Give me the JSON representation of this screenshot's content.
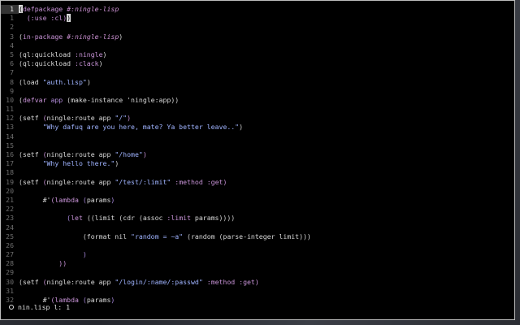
{
  "editor": {
    "lines": [
      {
        "num": "1",
        "current": true,
        "parts": [
          {
            "t": "(",
            "c": "cursor"
          },
          {
            "t": "defpackage ",
            "c": "kw"
          },
          {
            "t": "#:ningle-lisp",
            "c": "sym"
          }
        ]
      },
      {
        "num": "1",
        "parts": [
          {
            "t": "  (:use :cl)",
            "c": "paren2"
          },
          {
            "t": ")",
            "c": "cursor"
          }
        ]
      },
      {
        "num": "2",
        "parts": []
      },
      {
        "num": "3",
        "parts": [
          {
            "t": "(",
            "c": ""
          },
          {
            "t": "in-package ",
            "c": "kw"
          },
          {
            "t": "#:ningle-lisp",
            "c": "sym"
          },
          {
            "t": ")",
            "c": ""
          }
        ]
      },
      {
        "num": "4",
        "parts": []
      },
      {
        "num": "5",
        "parts": [
          {
            "t": "(ql:quickload ",
            "c": ""
          },
          {
            "t": ":ningle",
            "c": "kw"
          },
          {
            "t": ")",
            "c": ""
          }
        ]
      },
      {
        "num": "6",
        "parts": [
          {
            "t": "(ql:quickload ",
            "c": ""
          },
          {
            "t": ":clack",
            "c": "kw"
          },
          {
            "t": ")",
            "c": ""
          }
        ]
      },
      {
        "num": "7",
        "parts": []
      },
      {
        "num": "8",
        "parts": [
          {
            "t": "(load ",
            "c": ""
          },
          {
            "t": "\"auth.lisp\"",
            "c": "str"
          },
          {
            "t": ")",
            "c": ""
          }
        ]
      },
      {
        "num": "9",
        "parts": []
      },
      {
        "num": "10",
        "parts": [
          {
            "t": "(",
            "c": ""
          },
          {
            "t": "defvar ",
            "c": "kw"
          },
          {
            "t": "app ",
            "c": "kw2"
          },
          {
            "t": "(make-instance 'ningle:app))",
            "c": ""
          }
        ]
      },
      {
        "num": "11",
        "parts": []
      },
      {
        "num": "12",
        "parts": [
          {
            "t": "(setf ",
            "c": ""
          },
          {
            "t": "(",
            "c": "paren2"
          },
          {
            "t": "ningle:route app ",
            "c": ""
          },
          {
            "t": "\"/\"",
            "c": "str"
          },
          {
            "t": ")",
            "c": "paren2"
          }
        ]
      },
      {
        "num": "13",
        "parts": [
          {
            "t": "      \"Why dafuq are you here, mate? Ya better leave..\"",
            "c": "str"
          },
          {
            "t": ")",
            "c": ""
          }
        ]
      },
      {
        "num": "14",
        "parts": []
      },
      {
        "num": "15",
        "parts": []
      },
      {
        "num": "16",
        "parts": [
          {
            "t": "(setf ",
            "c": ""
          },
          {
            "t": "(",
            "c": "paren2"
          },
          {
            "t": "ningle:route app ",
            "c": ""
          },
          {
            "t": "\"/home\"",
            "c": "str"
          },
          {
            "t": ")",
            "c": "paren2"
          }
        ]
      },
      {
        "num": "17",
        "parts": [
          {
            "t": "      \"Why hello there.\"",
            "c": "str"
          },
          {
            "t": ")",
            "c": ""
          }
        ]
      },
      {
        "num": "18",
        "parts": []
      },
      {
        "num": "19",
        "parts": [
          {
            "t": "(setf ",
            "c": ""
          },
          {
            "t": "(",
            "c": "paren2"
          },
          {
            "t": "ningle:route app ",
            "c": ""
          },
          {
            "t": "\"/test/:limit\"",
            "c": "str"
          },
          {
            "t": " :method :get",
            "c": "kw"
          },
          {
            "t": ")",
            "c": "paren2"
          }
        ]
      },
      {
        "num": "20",
        "parts": []
      },
      {
        "num": "21",
        "parts": [
          {
            "t": "      #'",
            "c": ""
          },
          {
            "t": "(",
            "c": "paren2"
          },
          {
            "t": "lambda ",
            "c": "kw"
          },
          {
            "t": "(",
            "c": "paren3"
          },
          {
            "t": "params",
            "c": ""
          },
          {
            "t": ")",
            "c": "paren3"
          }
        ]
      },
      {
        "num": "22",
        "parts": []
      },
      {
        "num": "23",
        "parts": [
          {
            "t": "            (",
            "c": "paren3"
          },
          {
            "t": "let ",
            "c": "kw"
          },
          {
            "t": "((limit (cdr (assoc ",
            "c": ""
          },
          {
            "t": ":limit",
            "c": "kw"
          },
          {
            "t": " params))))",
            "c": ""
          }
        ]
      },
      {
        "num": "24",
        "parts": []
      },
      {
        "num": "25",
        "parts": [
          {
            "t": "                (format nil ",
            "c": ""
          },
          {
            "t": "\"random = ~a\"",
            "c": "str"
          },
          {
            "t": " (random (parse-integer limit)))",
            "c": ""
          }
        ]
      },
      {
        "num": "26",
        "parts": []
      },
      {
        "num": "27",
        "parts": [
          {
            "t": "                )",
            "c": "paren3"
          }
        ]
      },
      {
        "num": "28",
        "parts": [
          {
            "t": "          ))",
            "c": "paren2"
          }
        ]
      },
      {
        "num": "29",
        "parts": []
      },
      {
        "num": "30",
        "parts": [
          {
            "t": "(setf ",
            "c": ""
          },
          {
            "t": "(",
            "c": "paren2"
          },
          {
            "t": "ningle:route app ",
            "c": ""
          },
          {
            "t": "\"/login/:name/:passwd\"",
            "c": "str"
          },
          {
            "t": " :method :get",
            "c": "kw"
          },
          {
            "t": ")",
            "c": "paren2"
          }
        ]
      },
      {
        "num": "31",
        "parts": []
      },
      {
        "num": "32",
        "parts": [
          {
            "t": "      #'",
            "c": ""
          },
          {
            "t": "(",
            "c": "paren2"
          },
          {
            "t": "lambda ",
            "c": "kw"
          },
          {
            "t": "(",
            "c": "paren3"
          },
          {
            "t": "params",
            "c": ""
          },
          {
            "t": ")",
            "c": "paren3"
          }
        ]
      }
    ]
  },
  "statusbar": {
    "text": "nin.lisp l: 1"
  }
}
